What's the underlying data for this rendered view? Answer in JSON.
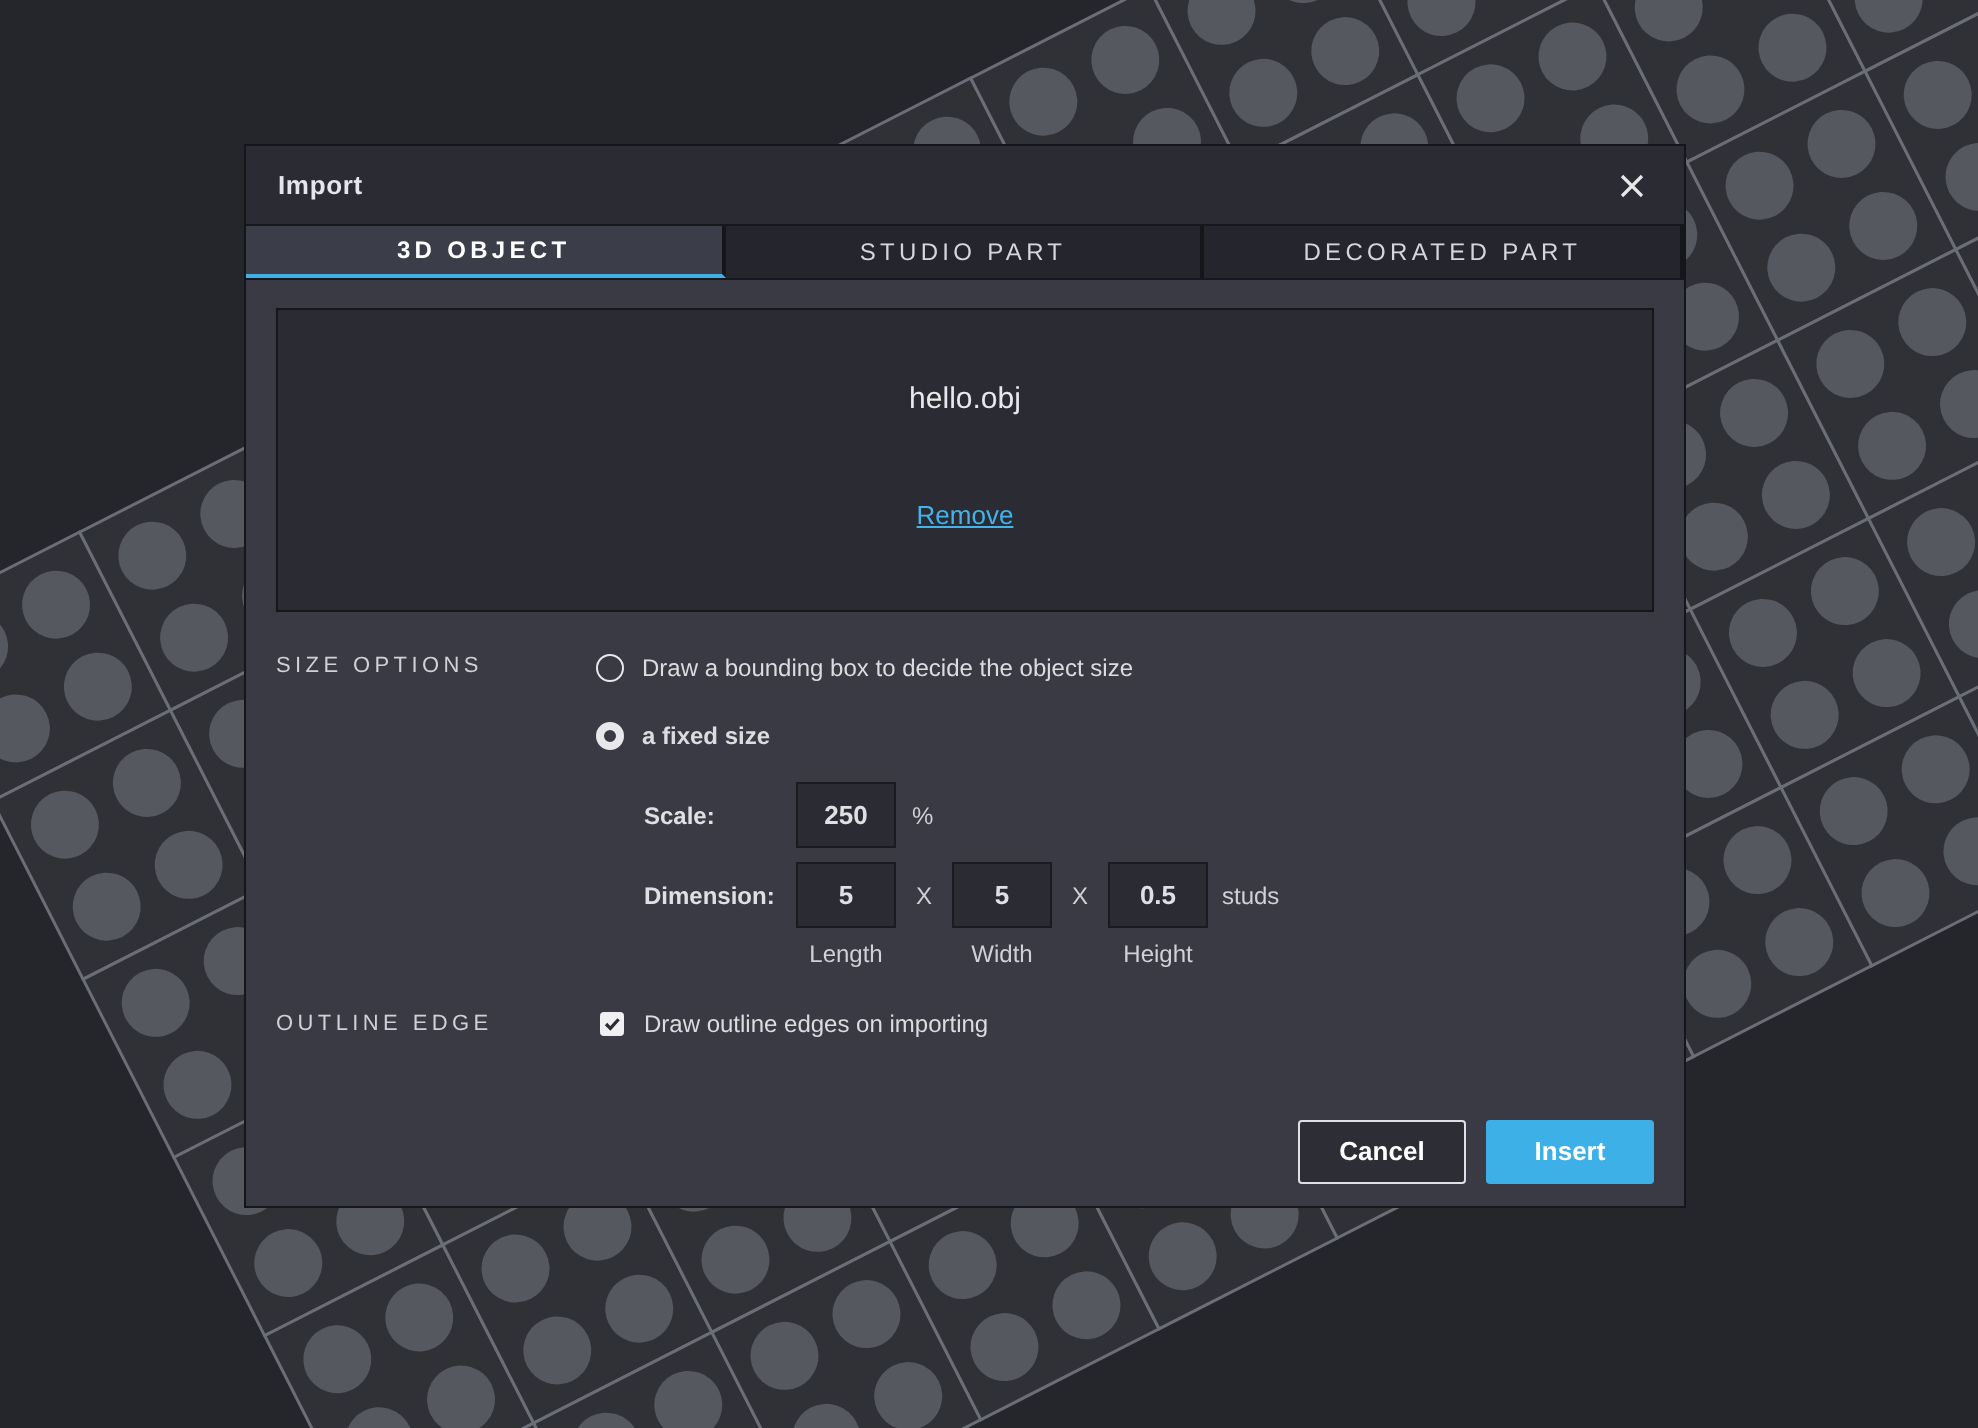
{
  "dialog": {
    "title": "Import",
    "tabs": [
      {
        "label": "3D OBJECT",
        "selected": true
      },
      {
        "label": "STUDIO PART",
        "selected": false
      },
      {
        "label": "DECORATED PART",
        "selected": false
      }
    ],
    "file": {
      "name": "hello.obj",
      "remove_link": "Remove"
    },
    "size_options": {
      "label": "SIZE OPTIONS",
      "choices": [
        {
          "label": "Draw a bounding box to decide the object size",
          "selected": false
        },
        {
          "label": "a fixed size",
          "selected": true
        }
      ],
      "scale": {
        "label": "Scale:",
        "value": "250",
        "unit": "%"
      },
      "dimension": {
        "label": "Dimension:",
        "separators": [
          "X",
          "X"
        ],
        "unit": "studs",
        "fields": [
          {
            "value": "5",
            "caption": "Length"
          },
          {
            "value": "5",
            "caption": "Width"
          },
          {
            "value": "0.5",
            "caption": "Height"
          }
        ]
      }
    },
    "outline_edge": {
      "label": "OUTLINE EDGE",
      "option": "Draw outline edges on importing",
      "checked": true
    },
    "buttons": {
      "cancel": "Cancel",
      "insert": "Insert"
    }
  }
}
